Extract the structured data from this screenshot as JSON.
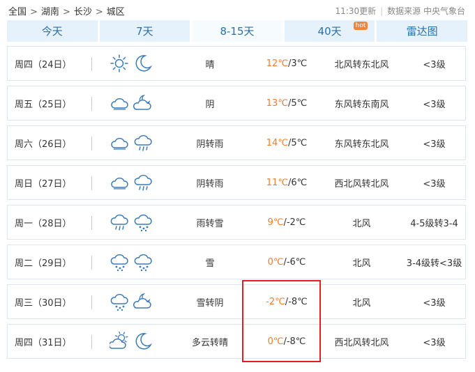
{
  "breadcrumb": [
    "全国",
    "湖南",
    "长沙",
    "城区"
  ],
  "update_time": "11:30更新",
  "data_source": "数据来源 中央气象台",
  "tabs": [
    {
      "label": "今天"
    },
    {
      "label": "7天"
    },
    {
      "label": "8-15天",
      "active": true
    },
    {
      "label": "40天",
      "badge": "hot"
    },
    {
      "label": "雷达图"
    }
  ],
  "forecast": [
    {
      "day": "周四（24日）",
      "icons": [
        "sun-icon",
        "moon-icon"
      ],
      "desc": "晴",
      "high": "12℃",
      "low": "3℃",
      "wind": "北风转东北风",
      "level": "<3级"
    },
    {
      "day": "周五（25日）",
      "icons": [
        "cloud-icon",
        "cloudy-night-icon"
      ],
      "desc": "阴",
      "high": "13℃",
      "low": "5℃",
      "wind": "东风转东南风",
      "level": "<3级"
    },
    {
      "day": "周六（26日）",
      "icons": [
        "cloud-icon",
        "rain-icon"
      ],
      "desc": "阴转雨",
      "high": "14℃",
      "low": "5℃",
      "wind": "东风转东北风",
      "level": "<3级"
    },
    {
      "day": "周日（27日）",
      "icons": [
        "cloud-icon",
        "rain-icon"
      ],
      "desc": "阴转雨",
      "high": "11℃",
      "low": "6℃",
      "wind": "西北风转北风",
      "level": "<3级"
    },
    {
      "day": "周一（28日）",
      "icons": [
        "rain-icon",
        "snow-icon"
      ],
      "desc": "雨转雪",
      "high": "9℃",
      "low": "-2℃",
      "wind": "北风",
      "level": "4-5级转3-4"
    },
    {
      "day": "周二（29日）",
      "icons": [
        "snow-icon",
        "snow-icon"
      ],
      "desc": "雪",
      "high": "0℃",
      "low": "-6℃",
      "wind": "北风",
      "level": "3-4级转<3级"
    },
    {
      "day": "周三（30日）",
      "icons": [
        "snow-icon",
        "cloudy-night-icon"
      ],
      "desc": "雪转阴",
      "high": "-2℃",
      "low": "-8℃",
      "wind": "北风",
      "level": "<3级"
    },
    {
      "day": "周四（31日）",
      "icons": [
        "partly-cloudy-icon",
        "moon-icon"
      ],
      "desc": "多云转晴",
      "high": "0℃",
      "low": "-8℃",
      "wind": "西北风转北风",
      "level": "<3级"
    }
  ],
  "colors": {
    "tab_bg": "#e6f2fb",
    "tab_text": "#2a6fa8",
    "high_temp": "#f07d2e",
    "highlight": "#e02020",
    "icon_stroke": "#3a7ab8"
  }
}
